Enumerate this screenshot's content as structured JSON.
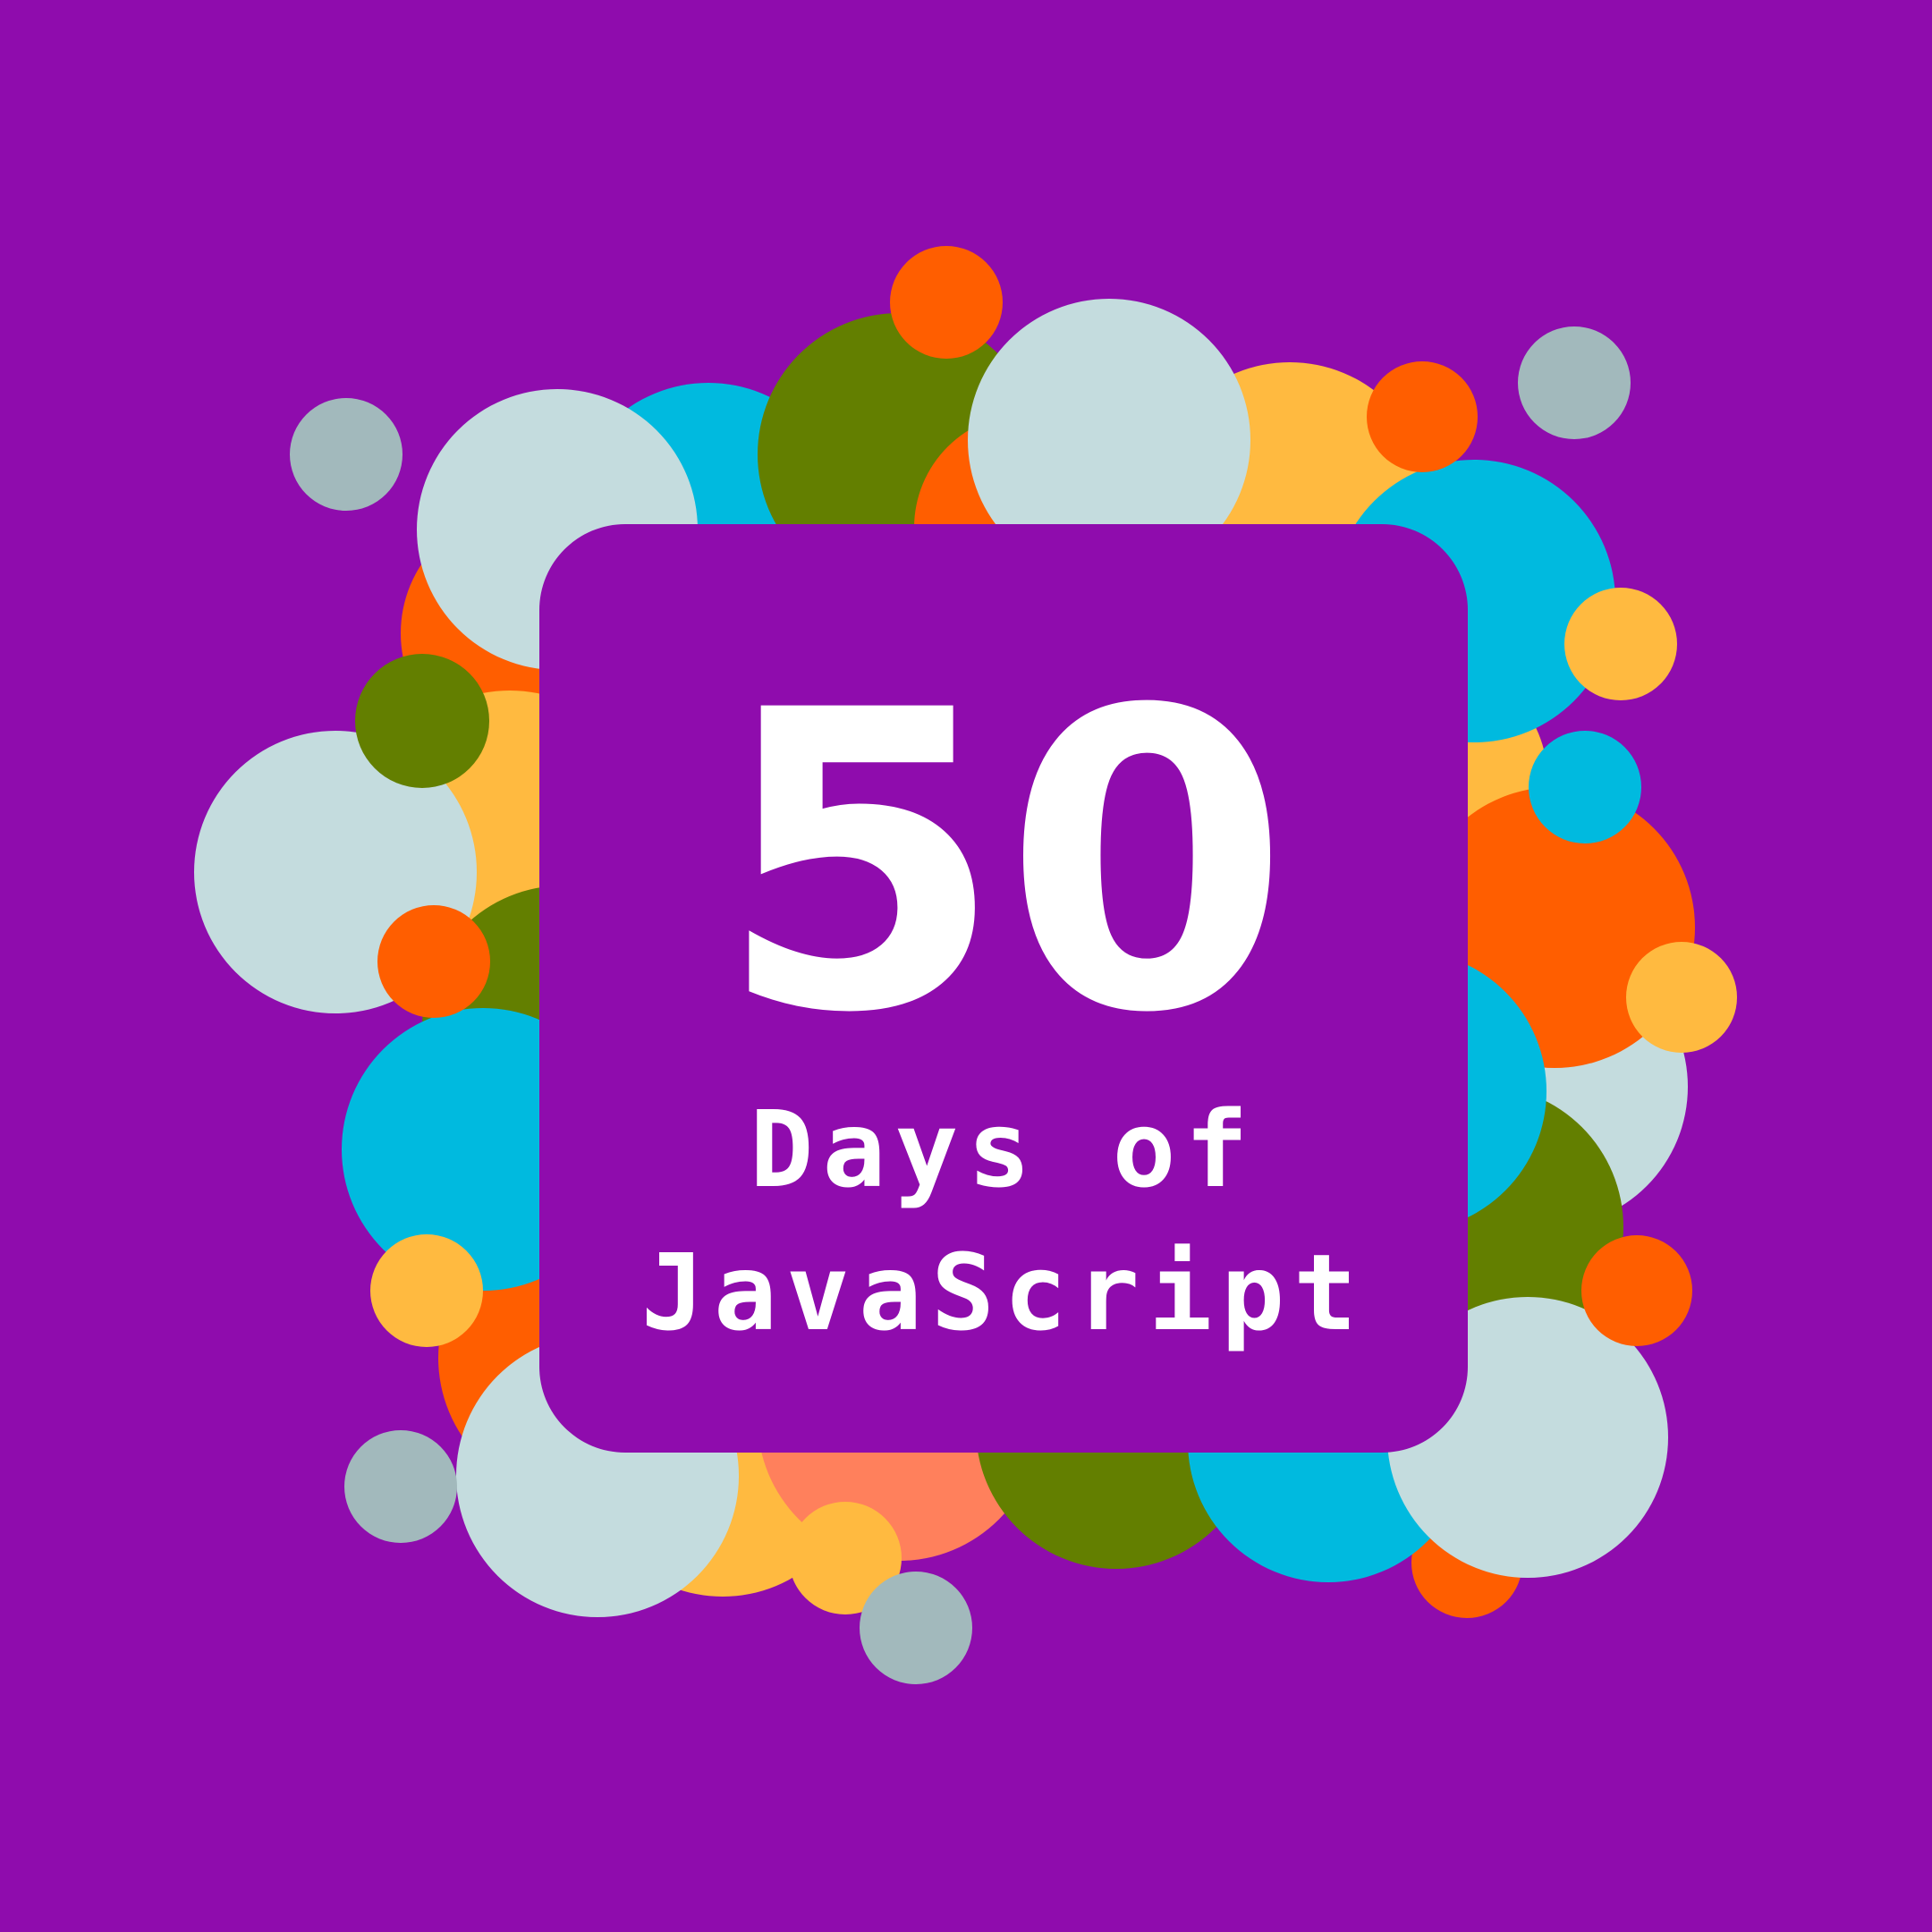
{
  "title": {
    "number": "50",
    "line1": "Days of",
    "line2": "JavaScript"
  },
  "colors": {
    "background": "#8f0cad",
    "card": "#8f0cad",
    "text": "#ffffff",
    "orange": "#ff5e00",
    "green": "#637f00",
    "cyan": "#00badf",
    "yellow": "#ffba40",
    "pale_blue": "#c4dcde",
    "gray_blue": "#a2b9bc",
    "salmon": "#ff805c"
  }
}
